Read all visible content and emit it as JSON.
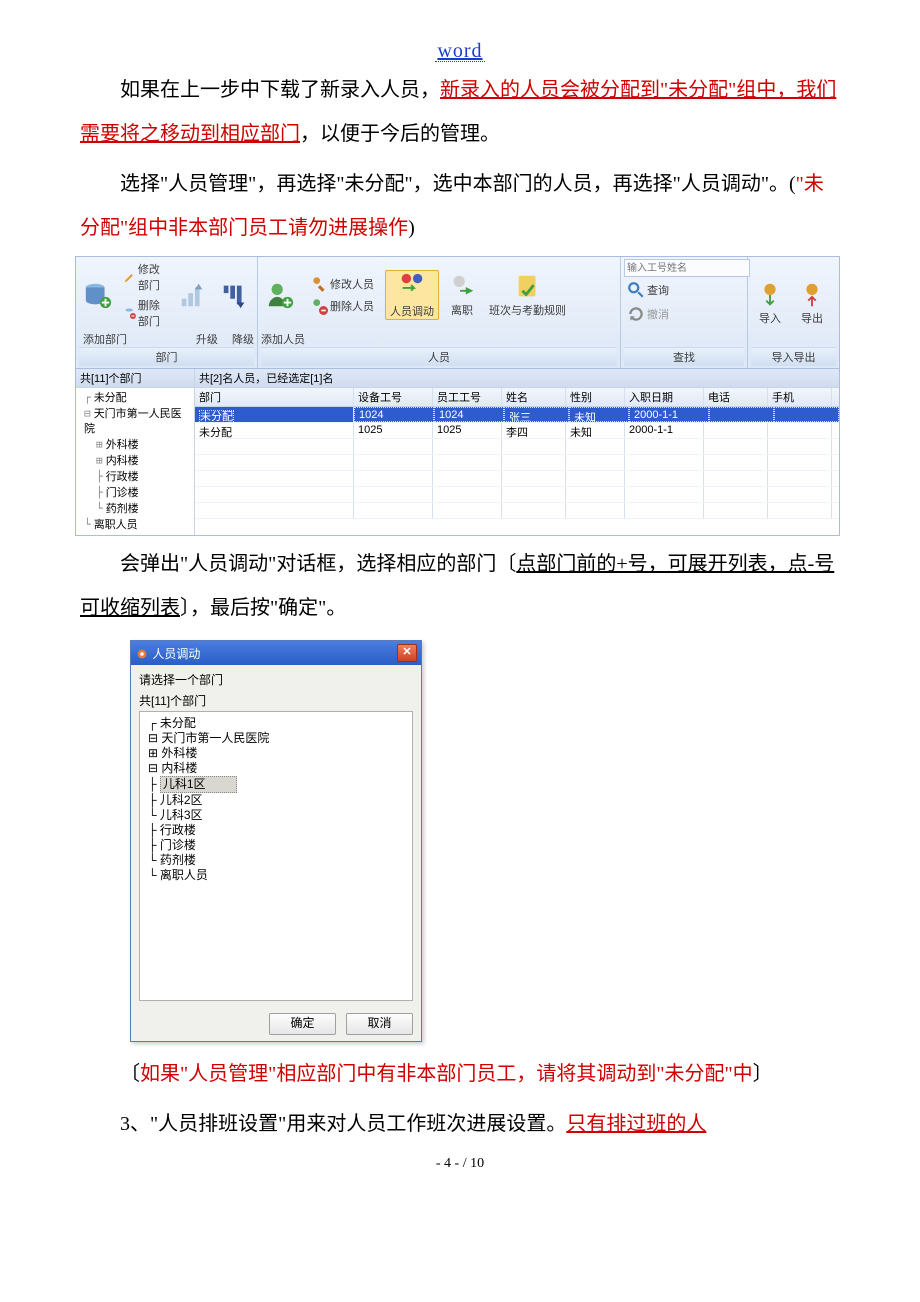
{
  "header": "word",
  "para1": {
    "a": "如果在上一步中下载了新录入人员，",
    "b": "新录入的人员会被分配到\"未分配\"组中，我们需要将之移动到相应部门",
    "c": "，以便于今后的管理。"
  },
  "para2": {
    "a": "选择\"人员管理\"，再选择\"未分配\"，选中本部门的人员，再选择\"人员调动\"。(",
    "b": "\"未分配\"组中非本部门员工请勿进展操作",
    "c": ")"
  },
  "toolbar": {
    "addDept": "添加部门",
    "modDept": "修改部门",
    "delDept": "删除部门",
    "upgrade": "升级",
    "downgrade": "降级",
    "addPerson": "添加人员",
    "modPerson": "修改人员",
    "delPerson": "删除人员",
    "transfer": "人员调动",
    "leave": "离职",
    "shiftRule": "班次与考勤规则",
    "searchPlaceholder": "输入工号姓名",
    "search": "查询",
    "cancelSearch": "撤消",
    "importBtn": "导入",
    "exportBtn": "导出",
    "groupDept": "部门",
    "groupPerson": "人员",
    "groupFind": "查找",
    "groupIO": "导入导出"
  },
  "leftPanel": {
    "count": "共[11]个部门",
    "nodes": [
      "未分配",
      "天门市第一人民医院",
      "外科楼",
      "内科楼",
      "行政楼",
      "门诊楼",
      "药剂楼",
      "离职人员"
    ]
  },
  "grid": {
    "countBar": "共[2]名人员，已经选定[1]名",
    "headers": {
      "dept": "部门",
      "dev": "设备工号",
      "emp": "员工工号",
      "name": "姓名",
      "sex": "性别",
      "date": "入职日期",
      "tel": "电话",
      "mob": "手机"
    },
    "rows": [
      {
        "dept": "未分配",
        "dev": "1024",
        "emp": "1024",
        "name": "张三",
        "sex": "未知",
        "date": "2000-1-1",
        "tel": "",
        "mob": ""
      },
      {
        "dept": "未分配",
        "dev": "1025",
        "emp": "1025",
        "name": "李四",
        "sex": "未知",
        "date": "2000-1-1",
        "tel": "",
        "mob": ""
      }
    ]
  },
  "para3": {
    "a": "会弹出\"人员调动\"对话框，选择相应的部门〔",
    "b": "点部门前的+号，可展开列表，点-号可收缩列表",
    "c": "〕，最后按\"确定\"。"
  },
  "dialog": {
    "title": "人员调动",
    "prompt": "请选择一个部门",
    "count": "共[11]个部门",
    "nodes": [
      "未分配",
      "天门市第一人民医院",
      "外科楼",
      "内科楼",
      "儿科1区",
      "儿科2区",
      "儿科3区",
      "行政楼",
      "门诊楼",
      "药剂楼",
      "离职人员"
    ],
    "ok": "确定",
    "cancel": "取消"
  },
  "para4": {
    "a": "〔",
    "b": "如果\"人员管理\"相应部门中有非本部门员工，请将其调动到\"未分配\"中",
    "c": "〕"
  },
  "para5": {
    "a": "3、\"人员排班设置\"用来对人员工作班次进展设置。",
    "b": "只有排过班的人"
  },
  "footer": "- 4 -  / 10"
}
